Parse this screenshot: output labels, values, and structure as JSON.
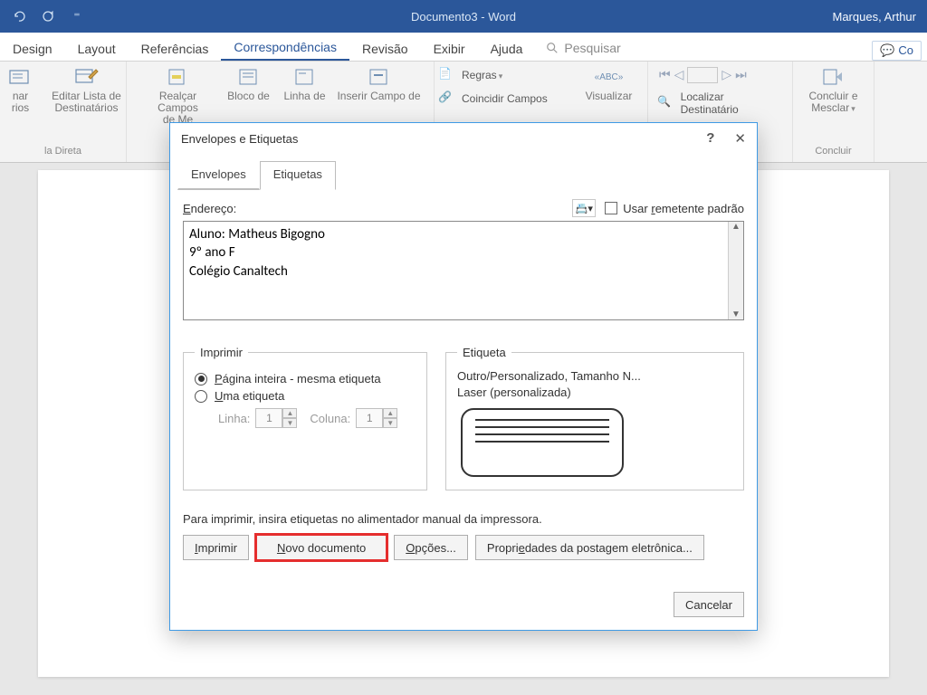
{
  "title_bar": {
    "document_title": "Documento3 - Word",
    "user_name": "Marques, Arthur"
  },
  "ribbon_tabs": {
    "design": "Design",
    "layout": "Layout",
    "referencias": "Referências",
    "correspondencias": "Correspondências",
    "revisao": "Revisão",
    "exibir": "Exibir",
    "ajuda": "Ajuda",
    "search_placeholder": "Pesquisar",
    "right_button": "Co"
  },
  "ribbon": {
    "iniciar_label": "nar\nrios",
    "editar_lista": "Editar Lista de\nDestinatários",
    "group1_label": "la Direta",
    "realcar": "Realçar Campos\nde Me",
    "bloco": "Bloco de",
    "linha": "Linha de",
    "inserir": "Inserir Campo de",
    "regras": "Regras",
    "coincidir": "Coincidir Campos",
    "visualizar": "Visualizar",
    "localizar": "Localizar Destinatário",
    "concluir": "Concluir e\nMesclar",
    "concluir_label": "Concluir"
  },
  "dialog": {
    "title": "Envelopes e Etiquetas",
    "tab_envelopes": "Envelopes",
    "tab_etiquetas": "Etiquetas",
    "endereco_label": "Endereço:",
    "usar_remetente": "Usar remetente padrão",
    "address_text": "Aluno: Matheus Bigogno\n9º ano F\nColégio Canaltech",
    "imprimir": {
      "legend": "Imprimir",
      "opt_pagina": "Página inteira - mesma etiqueta",
      "opt_uma": "Uma etiqueta",
      "linha_label": "Linha:",
      "linha_value": "1",
      "coluna_label": "Coluna:",
      "coluna_value": "1"
    },
    "etiqueta": {
      "legend": "Etiqueta",
      "desc1": "Outro/Personalizado, Tamanho N...",
      "desc2": "Laser (personalizada)"
    },
    "hint": "Para imprimir, insira etiquetas no alimentador manual da impressora.",
    "btn_imprimir": "Imprimir",
    "btn_novo": "Novo documento",
    "btn_opcoes": "Opções...",
    "btn_propriedades": "Propriedades da postagem eletrônica...",
    "btn_cancelar": "Cancelar"
  }
}
